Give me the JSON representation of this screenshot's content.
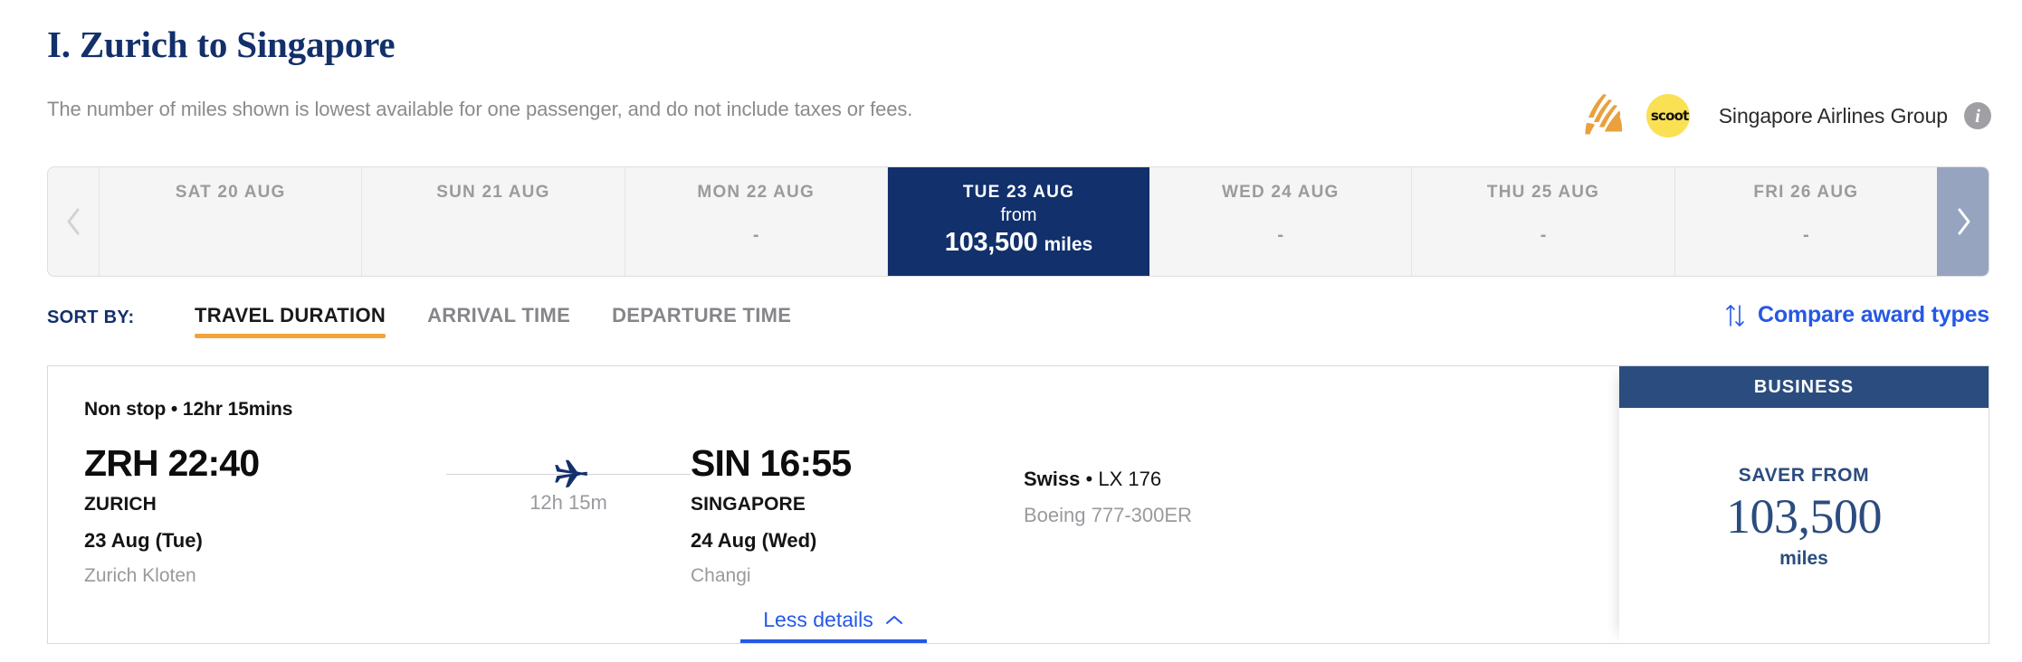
{
  "header": {
    "title": "I. Zurich to Singapore",
    "subtitle": "The number of miles shown is lowest available for one passenger, and do not include taxes or fees.",
    "airline_group_label": "Singapore Airlines Group",
    "scoot_wordmark": "scoot",
    "info_glyph": "i",
    "sia_logo_color": "#e8a13c",
    "scoot_badge_color": "#fae053"
  },
  "date_strip": {
    "prev_arrow": "chevron-left",
    "next_arrow": "chevron-right",
    "prev_enabled": false,
    "next_enabled": true,
    "selected_color": "#11306c",
    "tiles": [
      {
        "dow": "SAT 20 AUG",
        "value": "",
        "selected": false
      },
      {
        "dow": "SUN 21 AUG",
        "value": "",
        "selected": false
      },
      {
        "dow": "MON 22 AUG",
        "value": "-",
        "selected": false
      },
      {
        "dow": "TUE 23 AUG",
        "from_label": "from",
        "amount": "103,500",
        "unit": "miles",
        "selected": true
      },
      {
        "dow": "WED 24 AUG",
        "value": "-",
        "selected": false
      },
      {
        "dow": "THU 25 AUG",
        "value": "-",
        "selected": false
      },
      {
        "dow": "FRI 26 AUG",
        "value": "-",
        "selected": false
      }
    ]
  },
  "sort": {
    "label": "SORT BY:",
    "options": [
      {
        "label": "TRAVEL DURATION",
        "active": true
      },
      {
        "label": "ARRIVAL TIME",
        "active": false
      },
      {
        "label": "DEPARTURE TIME",
        "active": false
      }
    ],
    "active_underline_color": "#f2a33c",
    "compare_label": "Compare award types",
    "compare_icon": "up-down-arrows",
    "compare_color": "#2558e6"
  },
  "flight": {
    "stops_summary": "Non stop • 12hr 15mins",
    "origin": {
      "code_time": "ZRH 22:40",
      "city": "ZURICH",
      "date": "23 Aug (Tue)",
      "airport": "Zurich Kloten"
    },
    "destination": {
      "code_time": "SIN 16:55",
      "city": "SINGAPORE",
      "date": "24 Aug (Wed)",
      "airport": "Changi"
    },
    "leg": {
      "duration": "12h 15m",
      "plane_icon": "airplane-right"
    },
    "operator": {
      "carrier": "Swiss",
      "separator": "•",
      "flight_number": "LX 176",
      "aircraft": "Boeing 777-300ER"
    },
    "details_toggle": {
      "label": "Less details",
      "chevron": "chevron-up"
    }
  },
  "cabin": {
    "class_label": "BUSINESS",
    "fare_label": "SAVER FROM",
    "amount": "103,500",
    "unit": "miles",
    "header_color": "#2b4c7e",
    "text_color": "#2b4c7e"
  }
}
